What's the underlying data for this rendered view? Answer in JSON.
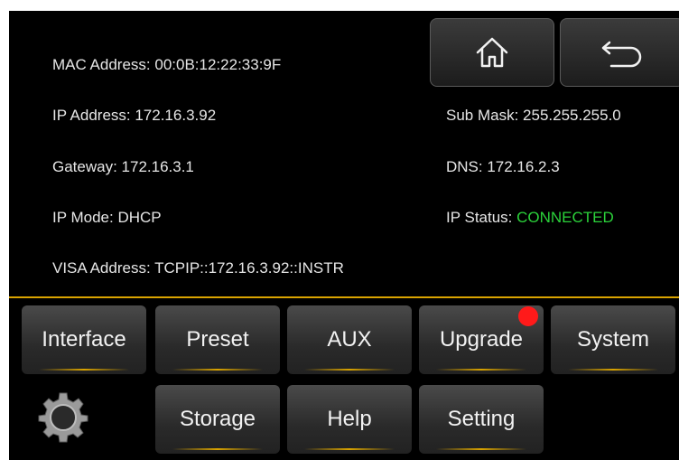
{
  "network": {
    "mac": "MAC Address: 00:0B:12:22:33:9F",
    "ip": "IP Address: 172.16.3.92",
    "submask": "Sub Mask: 255.255.255.0",
    "gateway": "Gateway: 172.16.3.1",
    "dns": "DNS: 172.16.2.3",
    "ip_mode": "IP Mode: DHCP",
    "ip_status_label": "IP Status: ",
    "ip_status_value": "CONNECTED",
    "visa": "VISA Address: TCPIP::172.16.3.92::INSTR"
  },
  "colors": {
    "status_ok": "#2bd23a",
    "accent": "#d9a300",
    "notification": "#ff1a1a"
  },
  "top_buttons": {
    "home_icon": "home-icon",
    "back_icon": "back-arrow-icon"
  },
  "menu": {
    "row1": [
      "Interface",
      "Preset",
      "AUX",
      "Upgrade",
      "System"
    ],
    "row2": [
      "Storage",
      "Help",
      "Setting"
    ]
  },
  "logo_icon": "gear-logo-icon"
}
